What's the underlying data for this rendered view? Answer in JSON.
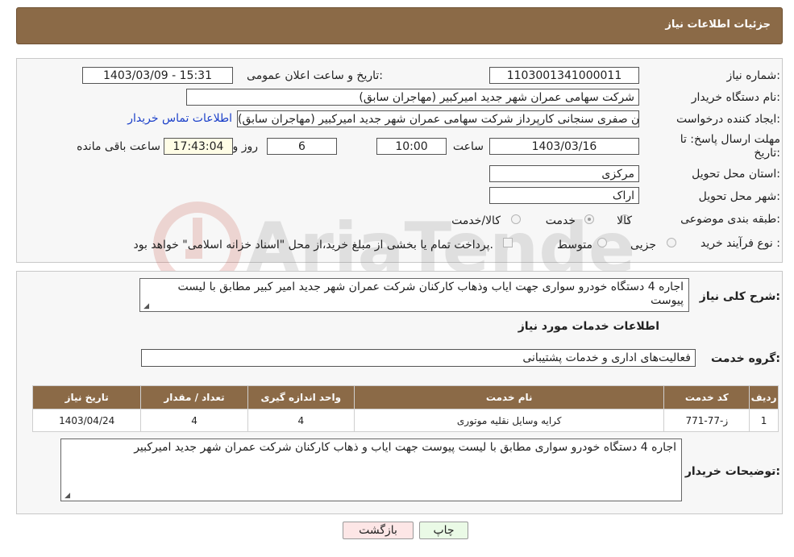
{
  "header": {
    "title": "جزئیات اطلاعات نیاز"
  },
  "form": {
    "need_number_label": "شماره نیاز:",
    "need_number": "1103001341000011",
    "announce_label": "تاریخ و ساعت اعلان عمومی:",
    "announce_value": "1403/03/09 - 15:31",
    "buyer_label": "نام دستگاه خریدار:",
    "buyer_value": "شرکت سهامی عمران شهر جدید امیرکبیر (مهاجران سابق)",
    "creator_label": "ایجاد کننده درخواست:",
    "creator_value": "احسان صفری سنجانی کارپرداز شرکت سهامی عمران شهر جدید امیرکبیر (مهاجران سابق)",
    "contact_link": "اطلاعات تماس خریدار",
    "deadline_label_1": "مهلت ارسال پاسخ: تا",
    "deadline_label_2": "تاریخ:",
    "deadline_date": "1403/03/16",
    "time_label": "ساعت",
    "deadline_time": "10:00",
    "days_value": "6",
    "days_label": "روز و",
    "remaining_time": "17:43:04",
    "remaining_label": "ساعت باقی مانده",
    "province_label": "استان محل تحویل:",
    "province_value": "مرکزی",
    "city_label": "شهر محل تحویل:",
    "city_value": "اراک",
    "category_label": "طبقه بندی موضوعی:",
    "category_options": [
      "کالا",
      "خدمت",
      "کالا/خدمت"
    ],
    "category_selected": "خدمت",
    "process_label": "نوع فرآیند خرید :",
    "process_options": [
      "جزیی",
      "متوسط"
    ],
    "process_note": "پرداخت تمام یا بخشی از مبلغ خرید،از محل \"اسناد خزانه اسلامی\" خواهد بود."
  },
  "summary": {
    "label": "شرح کلی نیاز:",
    "value": "اجاره 4 دستگاه خودرو سواری جهت ایاب وذهاب کارکنان شرکت عمران شهر جدید امیر کبیر مطابق با لیست پیوست"
  },
  "services": {
    "title": "اطلاعات خدمات مورد نیاز",
    "group_label": "گروه خدمت:",
    "group_value": "فعالیت‌های اداری و خدمات پشتیبانی",
    "columns": [
      "ردیف",
      "کد خدمت",
      "نام خدمت",
      "واحد اندازه گیری",
      "تعداد / مقدار",
      "تاریخ نیاز"
    ],
    "rows": [
      [
        "1",
        "ز-77-771",
        "کرایه وسایل نقلیه موتوری",
        "4",
        "4",
        "1403/04/24"
      ]
    ]
  },
  "buyer_notes": {
    "label": "توضیحات خریدار:",
    "value": "اجاره 4 دستگاه خودرو سواری مطابق با لیست پیوست جهت ایاب و ذهاب کارکنان شرکت عمران شهر جدید امیرکبیر"
  },
  "buttons": {
    "print": "چاپ",
    "back": "بازگشت"
  },
  "watermark_text": "AriaTender.neT"
}
